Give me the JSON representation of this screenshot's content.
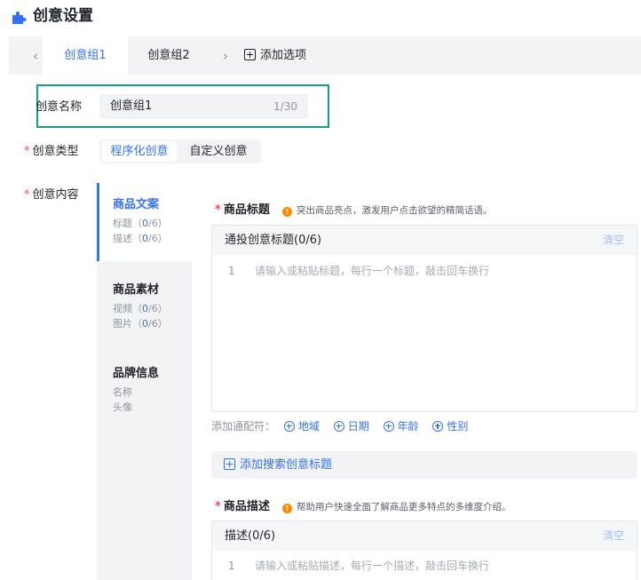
{
  "header": {
    "title": "创意设置",
    "icon": "puzzle-icon",
    "icon_color": "#3370ff"
  },
  "tabs": {
    "items": [
      {
        "label": "创意组1",
        "active": true
      },
      {
        "label": "创意组2",
        "active": false
      }
    ],
    "add_label": "添加选项"
  },
  "form": {
    "name": {
      "label": "创意名称",
      "value": "创意组1",
      "count": "1/30"
    },
    "type": {
      "required": "*",
      "label": "创意类型",
      "options": [
        "程序化创意",
        "自定义创意"
      ],
      "selected": "程序化创意"
    },
    "content": {
      "required": "*",
      "label": "创意内容"
    }
  },
  "categories": [
    {
      "title": "商品文案",
      "active": true,
      "subs": [
        {
          "label": "标题",
          "pre": "（",
          "num": "0",
          "post": "/6）"
        },
        {
          "label": "描述",
          "pre": "（",
          "num": "0",
          "post": "/6）"
        }
      ]
    },
    {
      "title": "商品素材",
      "active": false,
      "subs": [
        {
          "label": "视频",
          "pre": "（",
          "num": "0",
          "post": "/6）"
        },
        {
          "label": "图片",
          "pre": "（",
          "num": "0",
          "post": "/6）"
        }
      ]
    },
    {
      "title": "品牌信息",
      "active": false,
      "subs": [
        {
          "label": "名称"
        },
        {
          "label": "头像"
        }
      ]
    }
  ],
  "title_section": {
    "required": "*",
    "label": "商品标题",
    "hint": "突出商品亮点，激发用户点击欲望的精简话语。",
    "editor_title": "通投创意标题(0/6)",
    "clear": "清空",
    "line_no": "1",
    "placeholder": "请输入或粘贴标题，每行一个标题，敲击回车换行"
  },
  "wildcards": {
    "label": "添加通配符：",
    "items": [
      "地域",
      "日期",
      "年龄",
      "性别"
    ]
  },
  "add_search_title": "添加搜索创意标题",
  "desc_section": {
    "required": "*",
    "label": "商品描述",
    "hint": "帮助用户快速全面了解商品更多特点的多维度介绍。",
    "editor_title": "描述(0/6)",
    "clear": "清空",
    "line_no": "1",
    "placeholder": "请输入或粘贴描述，每行一个描述，敲击回车换行"
  },
  "colors": {
    "accent": "#3370ff",
    "required": "#f54a45",
    "highlight": "#159d85",
    "hint_icon": "#ff8800"
  }
}
